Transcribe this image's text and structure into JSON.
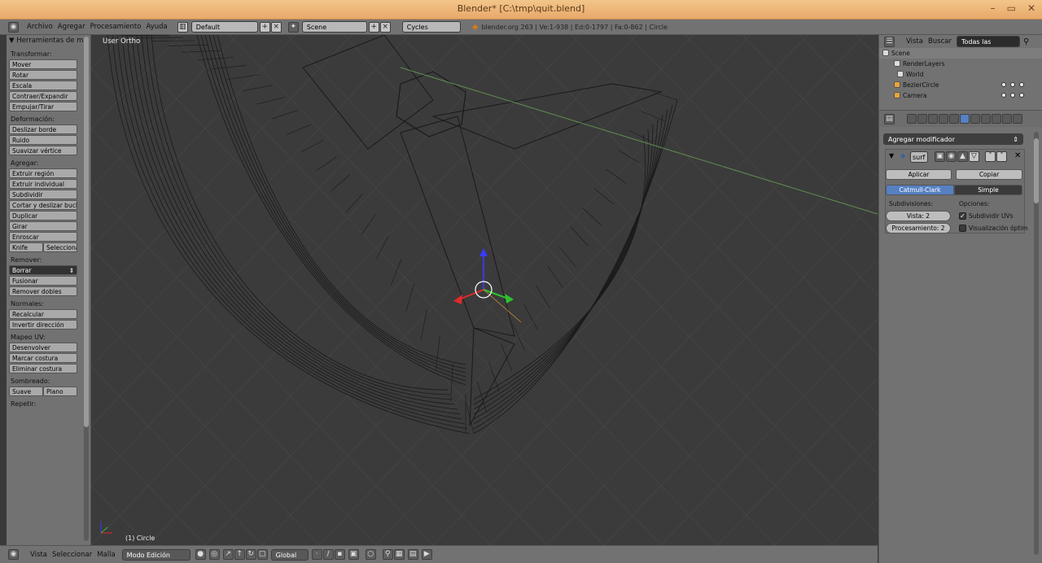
{
  "window": {
    "title": "Blender* [C:\\tmp\\quit.blend]",
    "buttons": [
      "–",
      "▭",
      "✕"
    ]
  },
  "top_header": {
    "menus": [
      "Archivo",
      "Agregar",
      "Procesamiento",
      "Ayuda"
    ],
    "screen_layout": "Default",
    "scene": "Scene",
    "render_engine": "Cycles",
    "info": "blender.org 263 | Ve:1-938 | Ed:0-1797 | Fa:0-862 | Circle"
  },
  "tool_shelf": {
    "header": "Herramientas de ma",
    "sections": [
      {
        "label": "Transformar:",
        "buttons": [
          "Mover",
          "Rotar",
          "Escala",
          "Contraer/Expandir",
          "Empujar/Tirar"
        ]
      },
      {
        "label": "Deformación:",
        "buttons": [
          "Deslizar borde",
          "Ruido",
          "Suavizar vértice"
        ]
      },
      {
        "label": "Agregar:",
        "buttons": [
          "Extruir región",
          "Extruir individual",
          "Subdividir",
          "Cortar y deslizar bucle",
          "Duplicar",
          "Girar",
          "Enroscar"
        ],
        "pair": [
          "Knife",
          "Seleccionar"
        ]
      },
      {
        "label": "Remover:",
        "dropdown": "Borrar",
        "buttons": [
          "Fusionar",
          "Remover dobles"
        ]
      },
      {
        "label": "Normales:",
        "buttons": [
          "Recalcular",
          "Invertir dirección"
        ]
      },
      {
        "label": "Mapeo UV:",
        "buttons": [
          "Desenvolver",
          "Marcar costura",
          "Eliminar costura"
        ]
      },
      {
        "label": "Sombreado:",
        "pair": [
          "Suave",
          "Plano"
        ]
      },
      {
        "label": "Repetir:"
      }
    ]
  },
  "viewport": {
    "view_label": "User Ortho",
    "object_label": "(1) Circle"
  },
  "bottom_header": {
    "menus": [
      "Vista",
      "Seleccionar",
      "Malla"
    ],
    "mode": "Modo Edición",
    "orientation": "Global"
  },
  "outliner": {
    "menus": [
      "Vista",
      "Buscar"
    ],
    "filter": "Todas las escena",
    "items": [
      "Scene",
      "RenderLayers",
      "World",
      "BezierCircle",
      "Camera"
    ]
  },
  "properties": {
    "add_modifier": "Agregar modificador",
    "modifier_name": "surf",
    "apply": "Aplicar",
    "copy": "Copiar",
    "algo_active": "Catmull-Clark",
    "algo_other": "Simple",
    "subdiv_label": "Subdivisiones:",
    "options_label": "Opciones:",
    "view_levels": "Vista: 2",
    "render_levels": "Procesamiento: 2",
    "opt_uv": "Subdividir UVs",
    "opt_optimal": "Visualización óptim"
  },
  "colors": {
    "accent_blue": "#5680c2",
    "title_bar": "#e8a96a",
    "panel": "#727272",
    "viewport": "#3b3b3b"
  }
}
